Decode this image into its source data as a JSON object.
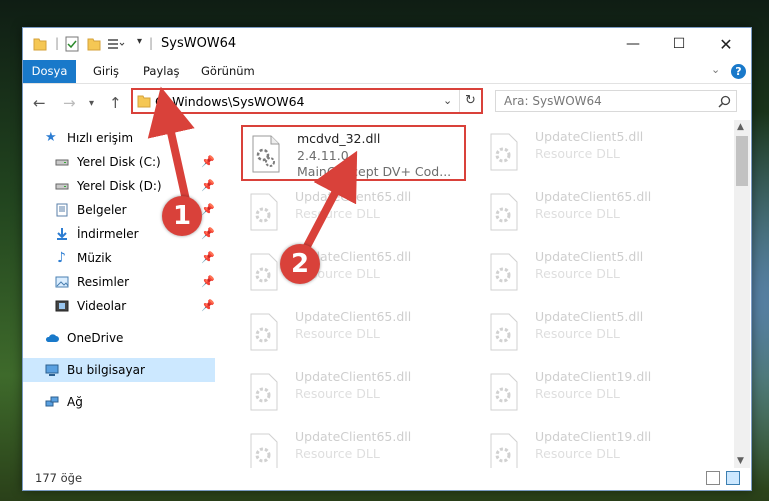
{
  "title_bar": {
    "title": "SysWOW64"
  },
  "ribbon": {
    "tabs": [
      "Dosya",
      "Giriş",
      "Paylaş",
      "Görünüm"
    ],
    "help": "?"
  },
  "address_bar": {
    "path": "C:\\Windows\\SysWOW64"
  },
  "search": {
    "placeholder": "Ara: SysWOW64"
  },
  "sidebar": {
    "items": [
      {
        "label": "Hızlı erişim",
        "icon": "star-icon"
      },
      {
        "label": "Yerel Disk (C:)",
        "icon": "drive-icon",
        "pinned": true
      },
      {
        "label": "Yerel Disk (D:)",
        "icon": "drive-icon",
        "pinned": true
      },
      {
        "label": "Belgeler",
        "icon": "documents-icon",
        "pinned": true
      },
      {
        "label": "İndirmeler",
        "icon": "download-icon",
        "pinned": true
      },
      {
        "label": "Müzik",
        "icon": "music-icon",
        "pinned": true
      },
      {
        "label": "Resimler",
        "icon": "pictures-icon",
        "pinned": true
      },
      {
        "label": "Videolar",
        "icon": "videos-icon",
        "pinned": true
      },
      {
        "label": "OneDrive",
        "icon": "cloud-icon"
      },
      {
        "label": "Bu bilgisayar",
        "icon": "computer-icon",
        "selected": true
      },
      {
        "label": "Ağ",
        "icon": "network-icon"
      }
    ]
  },
  "files": {
    "highlighted": {
      "name": "mcdvd_32.dll",
      "version": "2.4.11.0",
      "description": "MainConcept DV+ Cod..."
    },
    "ghost": [
      {
        "name": "UpdateClient5.dll",
        "sub": "Resource DLL"
      },
      {
        "name": "UpdateClient65.dll",
        "sub": "Resource DLL"
      },
      {
        "name": "UpdateClient65.dll",
        "sub": "Resource DLL"
      },
      {
        "name": "UpdateClient65.dll",
        "sub": "Resource DLL"
      },
      {
        "name": "UpdateClient5.dll",
        "sub": "Resource DLL"
      },
      {
        "name": "UpdateClient65.dll",
        "sub": "Resource DLL"
      },
      {
        "name": "UpdateClient5.dll",
        "sub": "Resource DLL"
      },
      {
        "name": "UpdateClient65.dll",
        "sub": "Resource DLL"
      },
      {
        "name": "UpdateClient19.dll",
        "sub": "Resource DLL"
      },
      {
        "name": "UpdateClient65.dll",
        "sub": "Resource DLL"
      },
      {
        "name": "UpdateClient19.dll",
        "sub": "Resource DLL"
      }
    ]
  },
  "status": {
    "count": "177 öğe"
  },
  "annotations": {
    "step1": "1",
    "step2": "2"
  },
  "colors": {
    "accent": "#1979ca",
    "highlight": "#d9413a",
    "selection": "#cce8ff"
  }
}
